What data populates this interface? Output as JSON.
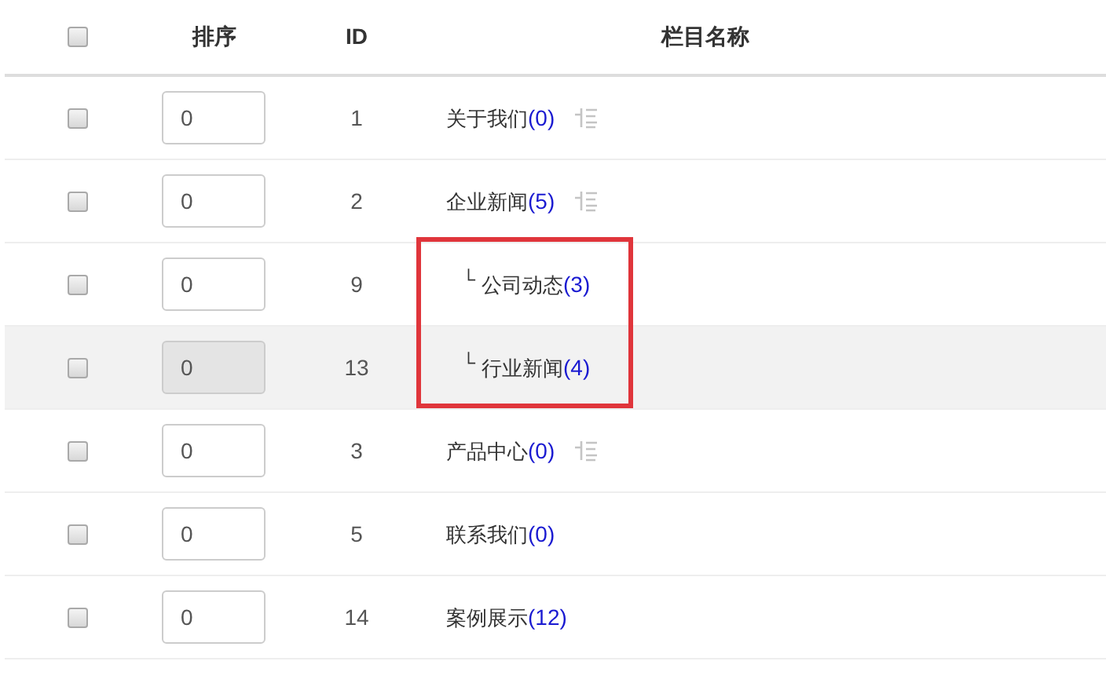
{
  "header": {
    "select_all": {
      "checked": false
    },
    "columns": [
      "排序",
      "ID",
      "栏目名称"
    ]
  },
  "rows": [
    {
      "checked": false,
      "order": "0",
      "order_disabled": false,
      "id": "1",
      "name": "关于我们",
      "count": "(0)",
      "tree_icon": true,
      "highlighted": false
    },
    {
      "checked": false,
      "order": "0",
      "order_disabled": false,
      "id": "2",
      "name": "企业新闻",
      "count": "(5)",
      "tree_icon": true,
      "highlighted": false,
      "children_boxed": true,
      "children": [
        {
          "checked": false,
          "order": "0",
          "order_disabled": false,
          "id": "9",
          "prefix": "└",
          "name": "公司动态",
          "count": "(3)",
          "tree_icon": false,
          "highlighted": false
        },
        {
          "checked": false,
          "order": "0",
          "order_disabled": true,
          "id": "13",
          "prefix": "└",
          "name": "行业新闻",
          "count": "(4)",
          "tree_icon": false,
          "highlighted": true
        }
      ]
    },
    {
      "checked": false,
      "order": "0",
      "order_disabled": false,
      "id": "3",
      "name": "产品中心",
      "count": "(0)",
      "tree_icon": true,
      "highlighted": false
    },
    {
      "checked": false,
      "order": "0",
      "order_disabled": false,
      "id": "5",
      "name": "联系我们",
      "count": "(0)",
      "tree_icon": false,
      "highlighted": false
    },
    {
      "checked": false,
      "order": "0",
      "order_disabled": false,
      "id": "14",
      "name": "案例展示",
      "count": "(12)",
      "tree_icon": false,
      "highlighted": false
    }
  ]
}
